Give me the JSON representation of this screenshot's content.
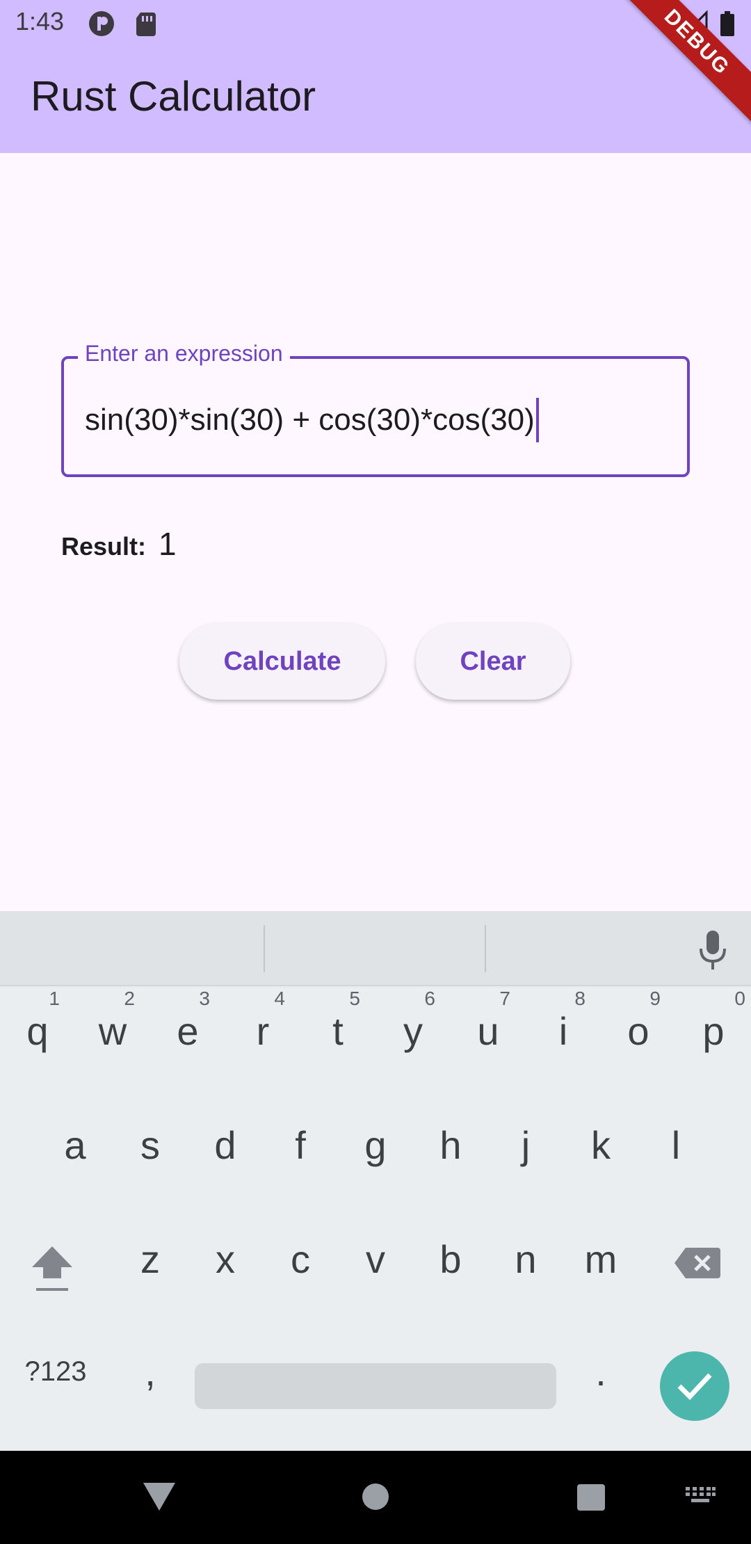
{
  "status_bar": {
    "time": "1:43"
  },
  "app_bar": {
    "title": "Rust Calculator",
    "debug_banner": "DEBUG"
  },
  "expression_input": {
    "label": "Enter an expression",
    "value": "sin(30)*sin(30) + cos(30)*cos(30)"
  },
  "result": {
    "label": "Result:",
    "value": "1"
  },
  "buttons": {
    "calculate": "Calculate",
    "clear": "Clear"
  },
  "keyboard": {
    "row1": [
      {
        "key": "q",
        "hint": "1"
      },
      {
        "key": "w",
        "hint": "2"
      },
      {
        "key": "e",
        "hint": "3"
      },
      {
        "key": "r",
        "hint": "4"
      },
      {
        "key": "t",
        "hint": "5"
      },
      {
        "key": "y",
        "hint": "6"
      },
      {
        "key": "u",
        "hint": "7"
      },
      {
        "key": "i",
        "hint": "8"
      },
      {
        "key": "o",
        "hint": "9"
      },
      {
        "key": "p",
        "hint": "0"
      }
    ],
    "row2": [
      "a",
      "s",
      "d",
      "f",
      "g",
      "h",
      "j",
      "k",
      "l"
    ],
    "row3": [
      "z",
      "x",
      "c",
      "v",
      "b",
      "n",
      "m"
    ],
    "symbols_label": "?123",
    "comma": ",",
    "period": "."
  },
  "colors": {
    "primary": "#6F43C0",
    "app_bar": "#D0BCFF",
    "background": "#FEF7FF",
    "done_key": "#4DB6AC",
    "debug": "#B71C1C"
  }
}
